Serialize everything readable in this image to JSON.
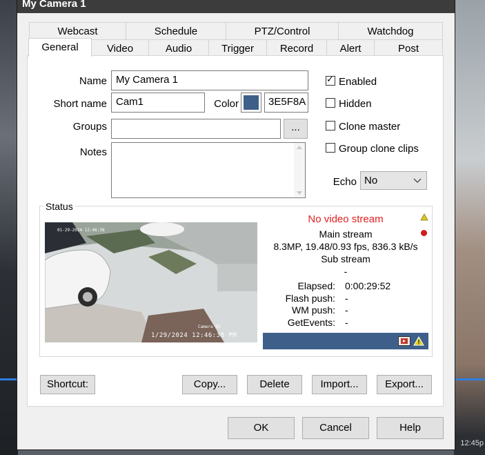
{
  "title": "My Camera 1",
  "tabs_row1": [
    "Webcast",
    "Schedule",
    "PTZ/Control",
    "Watchdog"
  ],
  "tabs_row2": [
    "General",
    "Video",
    "Audio",
    "Trigger",
    "Record",
    "Alert",
    "Post"
  ],
  "active_tab": "General",
  "form": {
    "name_label": "Name",
    "name_value": "My Camera 1",
    "short_name_label": "Short name",
    "short_name_value": "Cam1",
    "color_label": "Color",
    "color_hex": "3E5F8A",
    "color_swatch": "#3e5f8a",
    "groups_label": "Groups",
    "groups_value": "",
    "groups_browse": "...",
    "notes_label": "Notes",
    "notes_value": ""
  },
  "options": {
    "enabled_label": "Enabled",
    "enabled": true,
    "hidden_label": "Hidden",
    "hidden": false,
    "clone_master_label": "Clone master",
    "clone_master": false,
    "group_clone_label": "Group clone clips",
    "group_clone": false,
    "echo_label": "Echo",
    "echo_value": "No"
  },
  "status": {
    "label": "Status",
    "no_video": "No video stream",
    "main_stream": "Main stream",
    "main_stats": "8.3MP, 19.48/0.93 fps,  836.3 kB/s",
    "sub_stream": "Sub stream",
    "sub_value": "-",
    "elapsed_label": "Elapsed:",
    "elapsed_value": "0:00:29:52",
    "flash_label": "Flash push:",
    "flash_value": "-",
    "wm_label": "WM push:",
    "wm_value": "-",
    "getevents_label": "GetEvents:",
    "getevents_value": "-",
    "preview_timestamp": "1/29/2024 12:46:38 PM",
    "preview_cam_label": "Camera 01",
    "preview_top_ts": "01-29-2024 12:46:38",
    "warning_color": "#d9c21a",
    "record_color": "#d01b1b",
    "no_video_color": "#e02020"
  },
  "actions": {
    "shortcut": "Shortcut:",
    "copy": "Copy...",
    "delete": "Delete",
    "import": "Import...",
    "export": "Export..."
  },
  "footer": {
    "ok": "OK",
    "cancel": "Cancel",
    "help": "Help"
  },
  "background_timestamp": "12:45p"
}
